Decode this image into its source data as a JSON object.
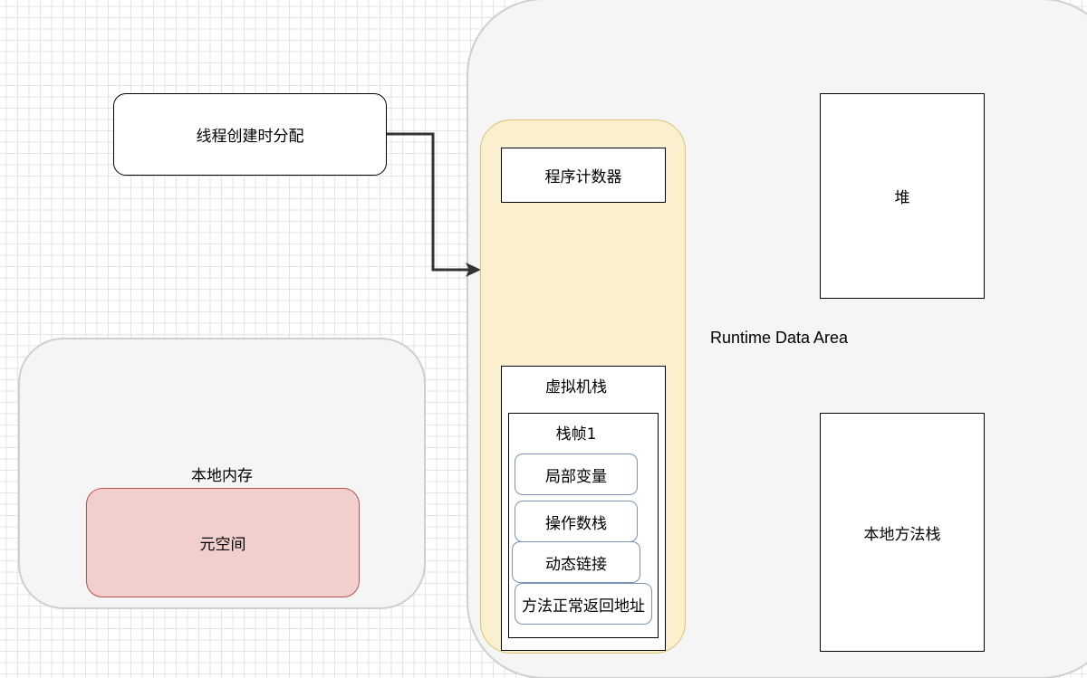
{
  "diagram": {
    "runtime_area_label": "Runtime Data Area",
    "thread_alloc_label": "线程创建时分配",
    "pc_label": "程序计数器",
    "jvm_stack_label": "虚拟机栈",
    "stack_frame_label": "栈帧1",
    "frame_items": [
      "局部变量",
      "操作数栈",
      "动态链接",
      "方法正常返回地址"
    ],
    "heap_label": "堆",
    "native_stack_label": "本地方法栈",
    "native_memory_label": "本地内存",
    "metaspace_label": "元空间"
  },
  "colors": {
    "thread_private_fill": "#fbf0ce",
    "metaspace_fill": "#f0cfcd",
    "metaspace_border": "#b85450",
    "frame_item_border": "#7a93b6",
    "container_fill": "#f5f5f5",
    "arrow": "#333333"
  }
}
